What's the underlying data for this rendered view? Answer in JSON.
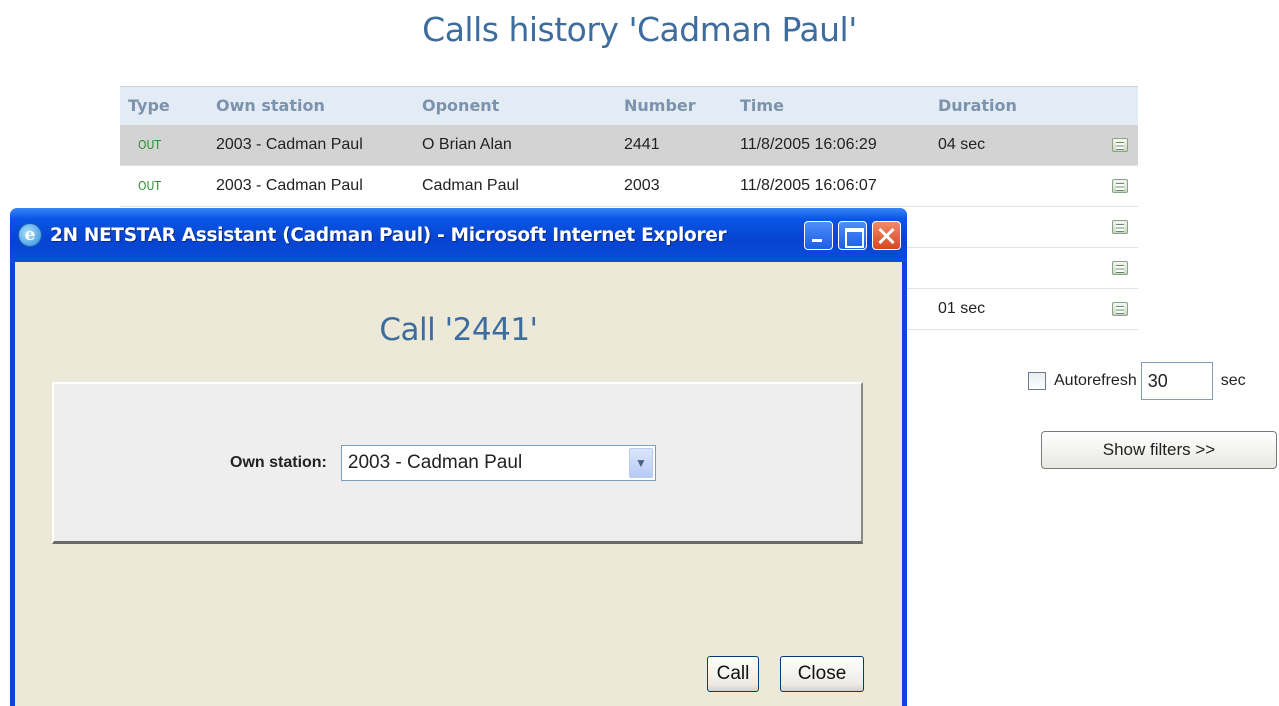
{
  "page": {
    "title": "Calls history 'Cadman Paul'"
  },
  "table": {
    "columns": [
      "Type",
      "Own station",
      "Oponent",
      "Number",
      "Time",
      "Duration"
    ],
    "rows": [
      {
        "type": "OUT",
        "own_station": "2003 - Cadman Paul",
        "oponent": "O Brian Alan",
        "number": "2441",
        "time": "11/8/2005 16:06:29",
        "duration": "04 sec"
      },
      {
        "type": "OUT",
        "own_station": "2003 - Cadman Paul",
        "oponent": "Cadman Paul",
        "number": "2003",
        "time": "11/8/2005 16:06:07",
        "duration": ""
      },
      {
        "type": "",
        "own_station": "",
        "oponent": "",
        "number": "",
        "time": "",
        "duration": ""
      },
      {
        "type": "",
        "own_station": "",
        "oponent": "",
        "number": "",
        "time": "",
        "duration": ""
      },
      {
        "type": "",
        "own_station": "",
        "oponent": "",
        "number": "",
        "time": "",
        "duration": "01 sec"
      }
    ],
    "row_icon": "detail-icon"
  },
  "controls": {
    "autorefresh_label": "Autorefresh",
    "autorefresh_checked": false,
    "autorefresh_value": "30",
    "autorefresh_unit": "sec",
    "show_filters_label": "Show filters  >>"
  },
  "popup": {
    "window_title": "2N NETSTAR Assistant (Cadman Paul) - Microsoft Internet Explorer",
    "dialog_title": "Call '2441'",
    "own_station_label": "Own station:",
    "own_station_value": "2003 - Cadman Paul",
    "call_button": "Call",
    "close_button": "Close"
  },
  "colors": {
    "title_blue": "#3d6c9e",
    "type_green": "#2e8b2e",
    "xp_titlebar": "#0643d0",
    "dialog_bg": "#ece9d8"
  }
}
